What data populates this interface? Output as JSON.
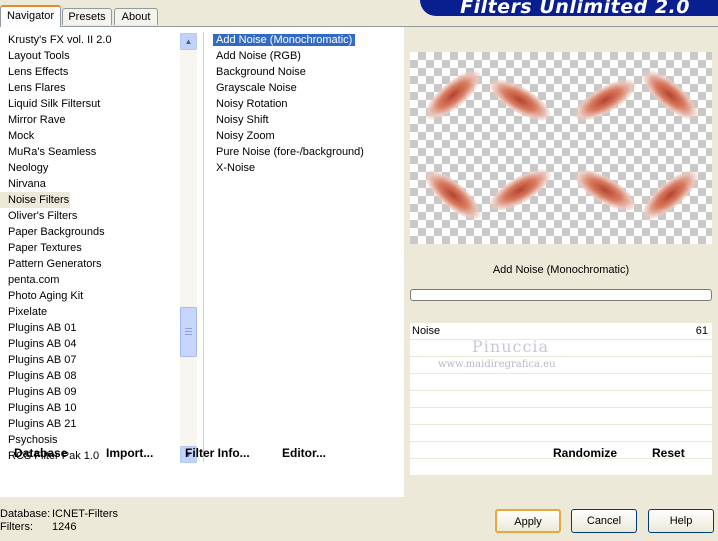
{
  "tabs": [
    {
      "label": "Navigator",
      "active": true
    },
    {
      "label": "Presets",
      "active": false
    },
    {
      "label": "About",
      "active": false
    }
  ],
  "banner_title": "Filters Unlimited 2.0",
  "categories": [
    "Krusty's FX vol. II 2.0",
    "Layout Tools",
    "Lens Effects",
    "Lens Flares",
    "Liquid Silk Filtersut",
    "Mirror Rave",
    "Mock",
    "MuRa's Seamless",
    "Neology",
    "Nirvana",
    "Noise Filters",
    "Oliver's Filters",
    "Paper Backgrounds",
    "Paper Textures",
    "Pattern Generators",
    "penta.com",
    "Photo Aging Kit",
    "Pixelate",
    "Plugins AB 01",
    "Plugins AB 04",
    "Plugins AB 07",
    "Plugins AB 08",
    "Plugins AB 09",
    "Plugins AB 10",
    "Plugins AB 21",
    "Psychosis",
    "RCS Filter Pak 1.0"
  ],
  "selected_category": "Noise Filters",
  "filters": [
    "Add Noise (Monochromatic)",
    "Add Noise (RGB)",
    "Background Noise",
    "Grayscale Noise",
    "Noisy Rotation",
    "Noisy Shift",
    "Noisy Zoom",
    "Pure Noise (fore-/background)",
    "X-Noise"
  ],
  "selected_filter": "Add Noise (Monochromatic)",
  "preview": {
    "filter_name": "Add Noise (Monochromatic)",
    "param_label": "Noise",
    "param_value": "61",
    "watermark_name": "Pinuccia",
    "watermark_url": "www.maidiregrafica.eu"
  },
  "left_buttons": {
    "database": "Database",
    "import": "Import...",
    "filter_info": "Filter Info...",
    "editor": "Editor..."
  },
  "right_buttons": {
    "randomize": "Randomize",
    "reset": "Reset"
  },
  "status": {
    "database_label": "Database:",
    "database_value": "ICNET-Filters",
    "filters_label": "Filters:",
    "filters_value": "1246"
  },
  "dialog_buttons": {
    "apply": "Apply",
    "cancel": "Cancel",
    "help": "Help"
  },
  "colors": {
    "selection": "#316ac5",
    "banner": "#0a1f8f",
    "window_bg": "#ece9d8"
  }
}
